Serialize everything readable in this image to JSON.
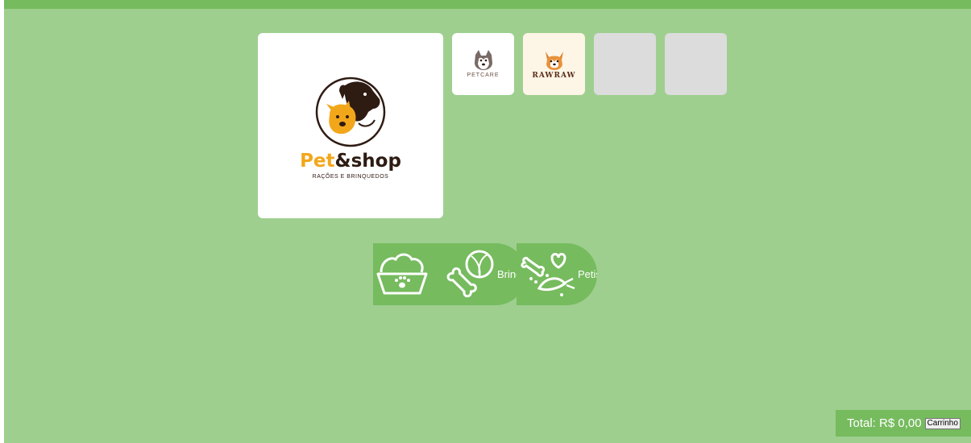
{
  "brand": {
    "name_part1": "Pet",
    "name_part2": "&shop",
    "tagline": "RAÇÕES E BRINQUEDOS"
  },
  "thumbnails": [
    {
      "label": "PETCARE"
    },
    {
      "label": "RAWRAW"
    },
    {
      "label": ""
    },
    {
      "label": ""
    }
  ],
  "categories": [
    {
      "label": "",
      "icon": "food-bowl-icon"
    },
    {
      "label": "Brinquedos",
      "icon": "bone-ball-icon"
    },
    {
      "label": "Petiscos",
      "icon": "treats-icon"
    }
  ],
  "cart": {
    "total_label": "Total: R$ 0,00",
    "button_label": "Carrinho"
  },
  "colors": {
    "background": "#9ecf8f",
    "accent": "#76bb5e",
    "brand_orange": "#f2a71b",
    "brand_dark": "#2e1b12"
  }
}
